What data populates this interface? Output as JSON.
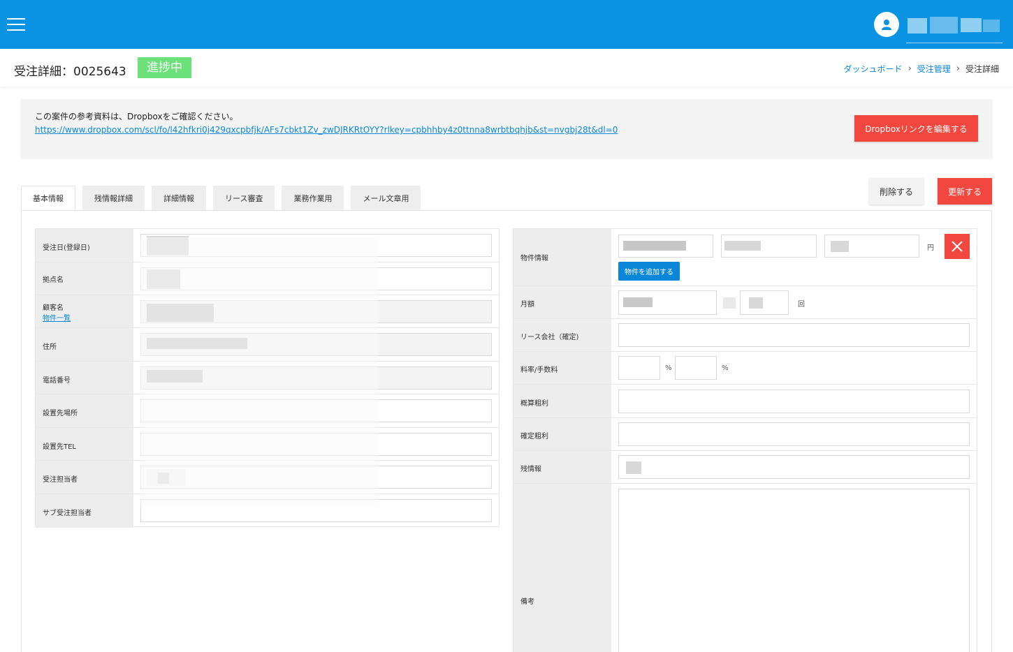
{
  "header": {
    "menu_icon": "hamburger-icon",
    "user_icon": "user-avatar-icon"
  },
  "page": {
    "title": "受注詳細：0025643",
    "status_badge": "進捗中",
    "breadcrumb": [
      "ダッシュボード",
      "受注管理",
      "受注詳細"
    ]
  },
  "notice": {
    "text": "この案件の参考資料は、Dropboxをご確認ください。",
    "link": "https://www.dropbox.com/scl/fo/l42hfkri0j429qxcpbfjk/AFs7cbkt1Zv_zwDJRKRtOYY?rlkey=cpbhhby4z0ttnna8wrbtbqhjb&st=nvgbj28t&dl=0",
    "edit_button": "Dropboxリンクを編集する"
  },
  "tabs": [
    "基本情報",
    "残情報詳細",
    "詳細情報",
    "リース審査",
    "業務作業用",
    "メール文章用"
  ],
  "actions": {
    "delete": "削除する",
    "update": "更新する"
  },
  "left_form": {
    "order_date": "受注日(登録日)",
    "branch": "拠点名",
    "customer": "顧客名",
    "property_list_link": "物件一覧",
    "address": "住所",
    "phone": "電話番号",
    "install_place": "設置先場所",
    "install_tel": "設置先TEL",
    "person": "受注担当者",
    "sub_person": "サブ受注担当者"
  },
  "right_form": {
    "property_info": "物件情報",
    "yen_unit": "円",
    "add_property_button": "物件を追加する",
    "monthly": "月額",
    "times_unit": "回",
    "lease_company": "リース会社（確定)",
    "rate_fee": "料率/手数料",
    "percent_unit": "%",
    "est_profit": "概算粗利",
    "confirmed_profit": "確定粗利",
    "remaining": "残情報",
    "remarks": "備考"
  }
}
